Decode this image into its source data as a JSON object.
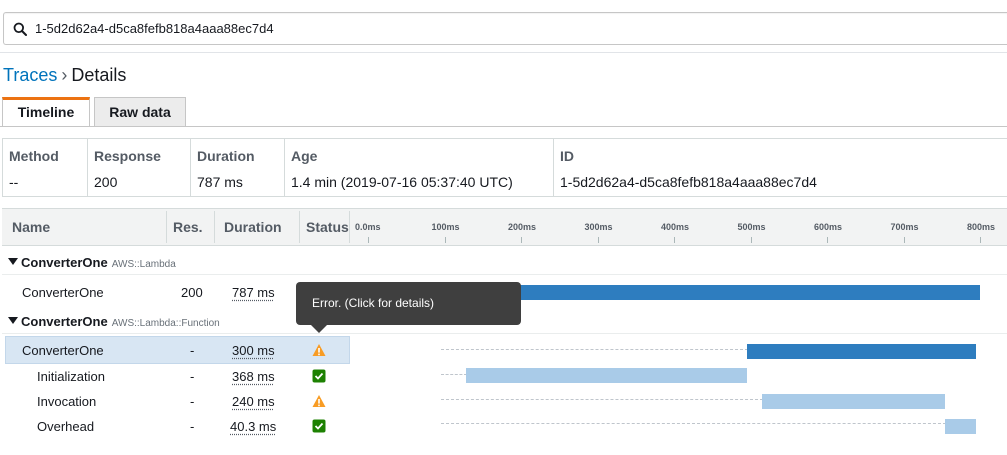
{
  "search": {
    "value": "1-5d2d62a4-d5ca8fefb818a4aaa88ec7d4"
  },
  "breadcrumb": {
    "parent": "Traces",
    "separator": "›",
    "current": "Details"
  },
  "tabs": [
    {
      "label": "Timeline",
      "active": true
    },
    {
      "label": "Raw data",
      "active": false
    }
  ],
  "summary": {
    "method": {
      "label": "Method",
      "value": "--"
    },
    "response": {
      "label": "Response",
      "value": "200"
    },
    "duration": {
      "label": "Duration",
      "value": "787 ms"
    },
    "age": {
      "label": "Age",
      "value": "1.4 min (2019-07-16 05:37:40 UTC)"
    },
    "id": {
      "label": "ID",
      "value": "1-5d2d62a4-d5ca8fefb818a4aaa88ec7d4"
    }
  },
  "table": {
    "headers": {
      "name": "Name",
      "res": "Res.",
      "duration": "Duration",
      "status": "Status"
    },
    "ticks": [
      "0.0ms",
      "100ms",
      "200ms",
      "300ms",
      "400ms",
      "500ms",
      "600ms",
      "700ms",
      "800ms"
    ],
    "groups": [
      {
        "name": "ConverterOne",
        "type": "AWS::Lambda",
        "rows": [
          {
            "name": "ConverterOne",
            "res": "200",
            "duration": "787 ms",
            "status": "none"
          }
        ]
      },
      {
        "name": "ConverterOne",
        "type": "AWS::Lambda::Function",
        "rows": [
          {
            "name": "ConverterOne",
            "res": "-",
            "duration": "300 ms",
            "status": "warning"
          },
          {
            "name": "Initialization",
            "res": "-",
            "duration": "368 ms",
            "status": "ok"
          },
          {
            "name": "Invocation",
            "res": "-",
            "duration": "240 ms",
            "status": "warning"
          },
          {
            "name": "Overhead",
            "res": "-",
            "duration": "40.3 ms",
            "status": "ok"
          }
        ]
      }
    ]
  },
  "tooltip": {
    "text": "Error. (Click for details)"
  },
  "colors": {
    "accent_tab": "#ec7211",
    "link": "#0073bb",
    "bar_primary": "#2e7dbf",
    "bar_secondary": "#a9cbe8",
    "warning": "#f89c24",
    "ok": "#1d8102"
  },
  "icons": {
    "search": "search-icon",
    "warning": "warning-icon",
    "ok": "check-icon",
    "expand": "caret-down-icon"
  }
}
